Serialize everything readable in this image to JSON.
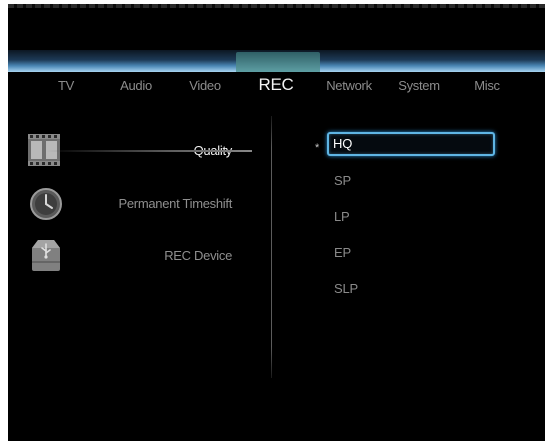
{
  "tabs": [
    {
      "label": "TV"
    },
    {
      "label": "Audio"
    },
    {
      "label": "Video"
    },
    {
      "label": "REC",
      "active": true
    },
    {
      "label": "Network"
    },
    {
      "label": "System"
    },
    {
      "label": "Misc"
    }
  ],
  "menu": [
    {
      "label": "Quality",
      "icon": "film-strip-icon",
      "selected": true
    },
    {
      "label": "Permanent Timeshift",
      "icon": "clock-icon"
    },
    {
      "label": "REC Device",
      "icon": "usb-drive-icon"
    }
  ],
  "options": {
    "current_marker": "*",
    "items": [
      "HQ",
      "SP",
      "LP",
      "EP",
      "SLP"
    ],
    "selected": "HQ"
  },
  "colors": {
    "background": "#000000",
    "accent": "#5fb5e4",
    "tab_highlight": "#5e9fa4",
    "text_active": "#f0f0f0",
    "text_inactive": "#8c8c8c"
  }
}
